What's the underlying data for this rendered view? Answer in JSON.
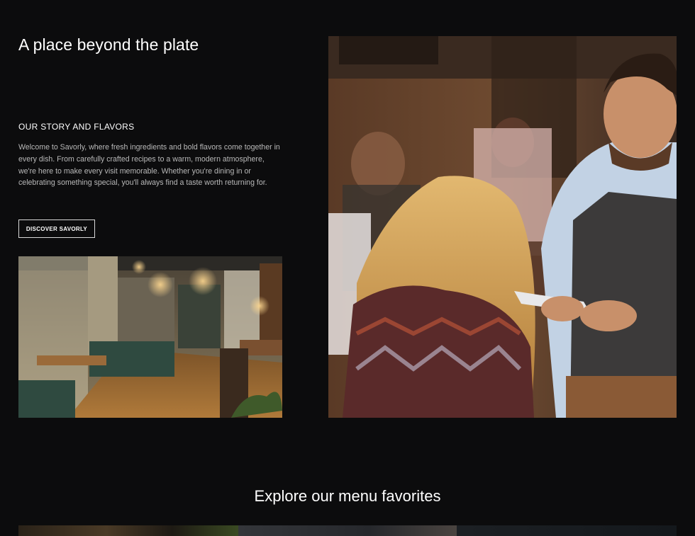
{
  "hero": {
    "title": "A place beyond the plate"
  },
  "story": {
    "heading": "OUR STORY AND FLAVORS",
    "body": "Welcome to Savorly, where fresh ingredients and bold flavors come together in every dish. From carefully crafted recipes to a warm, modern atmosphere, we're here to make every visit memorable. Whether you're dining in or celebrating something special, you'll always find a taste worth returning for.",
    "button_label": "DISCOVER SAVORLY"
  },
  "menu_section": {
    "title": "Explore our menu favorites"
  },
  "colors": {
    "background": "#0c0c0d",
    "text": "#ffffff",
    "muted_text": "#b9b9b9",
    "button_border": "#d9d9d9"
  }
}
